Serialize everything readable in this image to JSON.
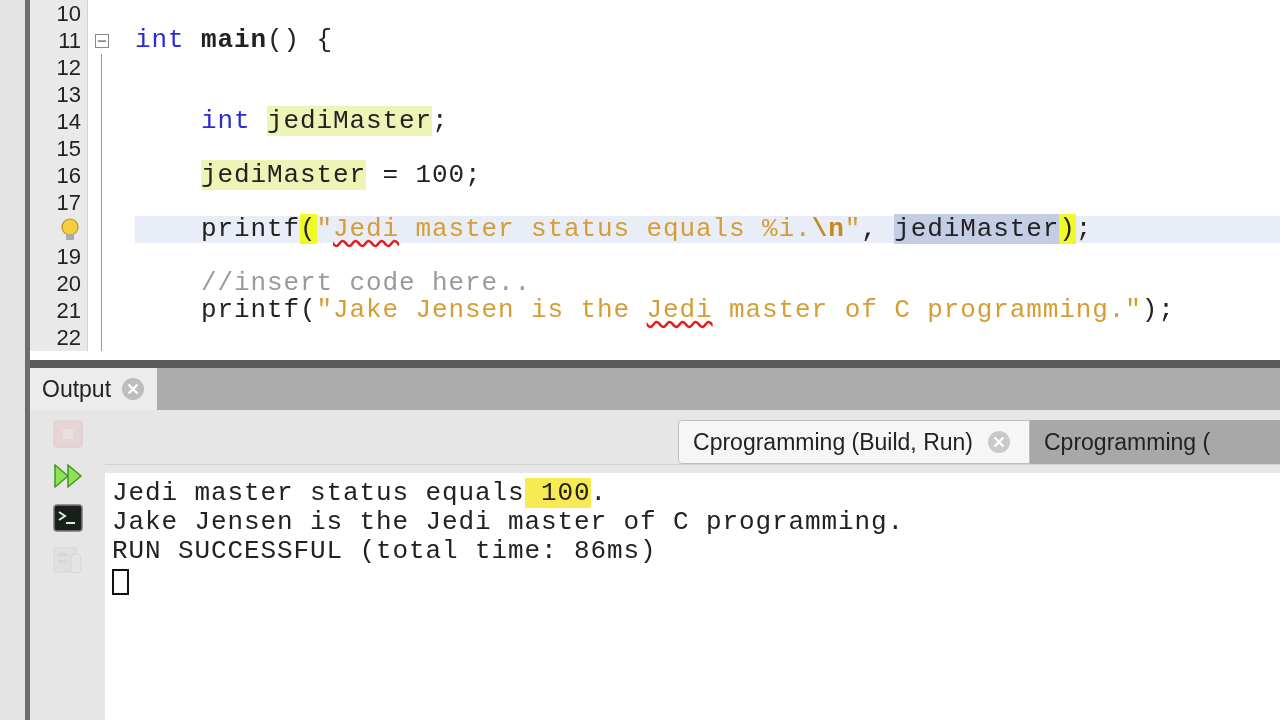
{
  "editor": {
    "lines": [
      {
        "number": "10"
      },
      {
        "number": "11",
        "fold": true,
        "tokens": [
          {
            "text": "int ",
            "kind": "keyword"
          },
          {
            "text": "main",
            "kind": "function"
          },
          {
            "text": "() {",
            "kind": "plain"
          }
        ]
      },
      {
        "number": "12"
      },
      {
        "number": "13"
      },
      {
        "number": "14",
        "indented": true,
        "tokens": [
          {
            "text": "int ",
            "kind": "keyword"
          },
          {
            "text": "jediMaster",
            "kind": "occurrence"
          },
          {
            "text": ";",
            "kind": "plain"
          }
        ]
      },
      {
        "number": "15"
      },
      {
        "number": "16",
        "indented": true,
        "tokens": [
          {
            "text": "jediMaster",
            "kind": "occurrence"
          },
          {
            "text": " = 100;",
            "kind": "plain"
          }
        ]
      },
      {
        "number": "17"
      },
      {
        "hint": true,
        "current": true,
        "indented": true,
        "tokens": [
          {
            "text": "printf",
            "kind": "plain"
          },
          {
            "text": "(",
            "kind": "match"
          },
          {
            "text": "\"",
            "kind": "string"
          },
          {
            "text": "Jedi",
            "kind": "misspelt"
          },
          {
            "text": " master status equals %i.",
            "kind": "string"
          },
          {
            "text": "\\n",
            "kind": "escape"
          },
          {
            "text": "\"",
            "kind": "string"
          },
          {
            "text": ", ",
            "kind": "plain"
          },
          {
            "text": "jediMaster",
            "kind": "selection"
          },
          {
            "text": ")",
            "kind": "match"
          },
          {
            "text": ";",
            "kind": "plain"
          }
        ]
      },
      {
        "number": "19"
      },
      {
        "number": "20",
        "indented": true,
        "tokens": [
          {
            "text": "//insert code here..",
            "kind": "comment"
          }
        ]
      },
      {
        "number": "21",
        "indented": true,
        "tokens": [
          {
            "text": "printf(",
            "kind": "plain"
          },
          {
            "text": "\"Jake Jensen is the ",
            "kind": "string"
          },
          {
            "text": "Jedi",
            "kind": "misspelt"
          },
          {
            "text": " master of C programming.\"",
            "kind": "string"
          },
          {
            "text": ");",
            "kind": "plain"
          }
        ]
      },
      {
        "number": "22"
      }
    ]
  },
  "output": {
    "tab": {
      "label": "Output",
      "selected": true
    },
    "toolbar": [
      {
        "kind": "stop",
        "disabled": true
      },
      {
        "kind": "rerun",
        "disabled": false
      },
      {
        "kind": "terminal",
        "disabled": false
      },
      {
        "kind": "settings",
        "disabled": true
      }
    ],
    "tabs": [
      {
        "label": "Cprogramming (Build, Run)",
        "selected": true,
        "closable": true
      },
      {
        "label": "Cprogramming (",
        "selected": false,
        "closable": false
      }
    ],
    "lines": [
      {
        "segments": [
          {
            "text": "Jedi master status equals",
            "highlight": false
          },
          {
            "text": " 100",
            "highlight": true
          },
          {
            "text": ".",
            "highlight": false
          }
        ]
      },
      {
        "segments": [
          {
            "text": "Jake Jensen is the Jedi master of C programming.",
            "highlight": false
          }
        ]
      },
      {
        "segments": [
          {
            "text": "RUN SUCCESSFUL (total time: 86ms)",
            "highlight": false
          }
        ]
      }
    ],
    "input_cursor": true
  }
}
